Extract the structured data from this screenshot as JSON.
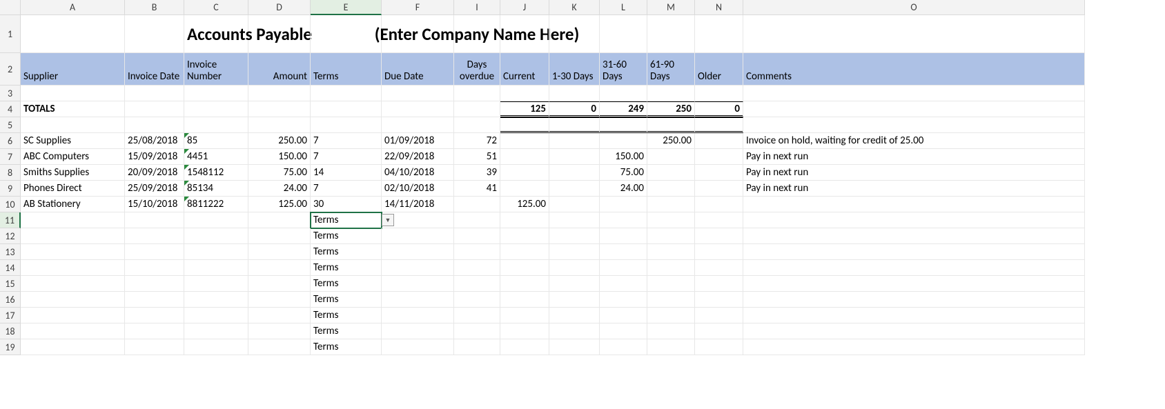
{
  "columns": [
    "A",
    "B",
    "C",
    "D",
    "E",
    "F",
    "I",
    "J",
    "K",
    "L",
    "M",
    "N",
    "O"
  ],
  "rowLabels": [
    "1",
    "2",
    "3",
    "4",
    "5",
    "6",
    "7",
    "8",
    "9",
    "10",
    "11",
    "12",
    "13",
    "14",
    "15",
    "16",
    "17",
    "18",
    "19"
  ],
  "title": "Accounts Payable",
  "companyPlaceholder": "(Enter Company Name Here)",
  "headers": {
    "supplier": "Supplier",
    "invoiceDate": "Invoice Date",
    "invoiceNumber": "Invoice Number",
    "amount": "Amount",
    "terms": "Terms",
    "dueDate": "Due Date",
    "daysOverdue": "Days overdue",
    "current": "Current",
    "bucket1": "1-30 Days",
    "bucket2": "31-60 Days",
    "bucket3": "61-90 Days",
    "older": "Older",
    "comments": "Comments"
  },
  "totals": {
    "label": "TOTALS",
    "current": "125",
    "b1": "0",
    "b2": "249",
    "b3": "250",
    "older": "0"
  },
  "rows": [
    {
      "supplier": "SC Supplies",
      "date": "25/08/2018",
      "inv": "85",
      "amount": "250.00",
      "terms": "7",
      "due": "01/09/2018",
      "overdue": "72",
      "current": "",
      "b1": "",
      "b2": "",
      "b3": "250.00",
      "older": "",
      "comment": "Invoice on hold, waiting for credit of 25.00"
    },
    {
      "supplier": "ABC Computers",
      "date": "15/09/2018",
      "inv": "4451",
      "amount": "150.00",
      "terms": "7",
      "due": "22/09/2018",
      "overdue": "51",
      "current": "",
      "b1": "",
      "b2": "150.00",
      "b3": "",
      "older": "",
      "comment": "Pay in next run"
    },
    {
      "supplier": "Smiths Supplies",
      "date": "20/09/2018",
      "inv": "1548112",
      "amount": "75.00",
      "terms": "14",
      "due": "04/10/2018",
      "overdue": "39",
      "current": "",
      "b1": "",
      "b2": "75.00",
      "b3": "",
      "older": "",
      "comment": "Pay in next run"
    },
    {
      "supplier": "Phones Direct",
      "date": "25/09/2018",
      "inv": "85134",
      "amount": "24.00",
      "terms": "7",
      "due": "02/10/2018",
      "overdue": "41",
      "current": "",
      "b1": "",
      "b2": "24.00",
      "b3": "",
      "older": "",
      "comment": "Pay in next run"
    },
    {
      "supplier": "AB Stationery",
      "date": "15/10/2018",
      "inv": "8811222",
      "amount": "125.00",
      "terms": "30",
      "due": "14/11/2018",
      "overdue": "",
      "current": "125.00",
      "b1": "",
      "b2": "",
      "b3": "",
      "older": "",
      "comment": ""
    }
  ],
  "activeCell": "Terms",
  "filler": [
    "Terms",
    "Terms",
    "Terms",
    "Terms",
    "Terms",
    "Terms",
    "Terms",
    "Terms"
  ]
}
